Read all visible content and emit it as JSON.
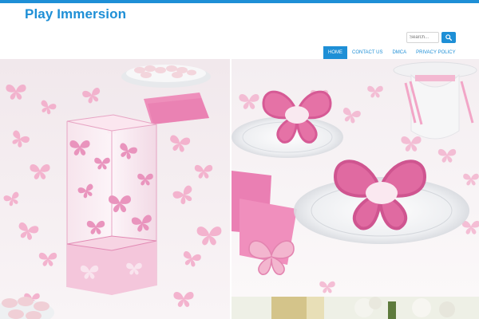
{
  "site": {
    "title": "Play Immersion"
  },
  "search": {
    "placeholder": "Search..."
  },
  "nav": {
    "items": [
      {
        "label": "HOME",
        "active": true
      },
      {
        "label": "CONTACT US",
        "active": false
      },
      {
        "label": "DMCA",
        "active": false
      },
      {
        "label": "PRIVACY POLICY",
        "active": false
      }
    ]
  },
  "colors": {
    "accent": "#1e8fd6",
    "pink": "#e97fb1",
    "light_pink": "#f6cfe0"
  },
  "gallery": {
    "images": [
      {
        "name": "pink-butterfly-vase-photo"
      },
      {
        "name": "butterfly-place-cards-photo"
      },
      {
        "name": "flowers-photo"
      }
    ]
  }
}
